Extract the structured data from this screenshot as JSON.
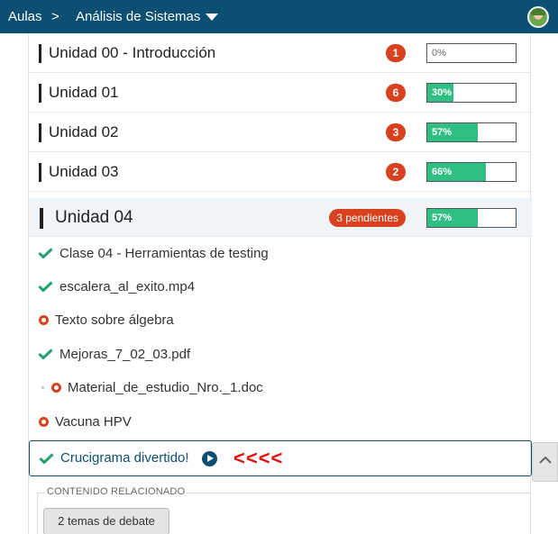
{
  "header": {
    "home_crumb": "Aulas",
    "separator": ">",
    "course_crumb": "Análisis de Sistemas"
  },
  "units": [
    {
      "title": "Unidad 00 - Introducción",
      "badge": "1",
      "progress_label": "0%",
      "progress": 0
    },
    {
      "title": "Unidad 01",
      "badge": "6",
      "progress_label": "30%",
      "progress": 0.3
    },
    {
      "title": "Unidad 02",
      "badge": "3",
      "progress_label": "57%",
      "progress": 0.57
    },
    {
      "title": "Unidad 03",
      "badge": "2",
      "progress_label": "66%",
      "progress": 0.66
    }
  ],
  "active_unit": {
    "title": "Unidad 04",
    "badge": "3 pendientes",
    "progress_label": "57%",
    "progress": 0.57
  },
  "items": [
    {
      "label": "Clase 04 - Herramientas de testing",
      "status": "done"
    },
    {
      "label": "escalera_al_exito.mp4",
      "status": "done"
    },
    {
      "label": "Texto sobre álgebra",
      "status": "pending"
    },
    {
      "label": "Mejoras_7_02_03.pdf",
      "status": "done"
    },
    {
      "label": "Material_de_estudio_Nro._1.doc",
      "status": "pending"
    },
    {
      "label": "Vacuna HPV",
      "status": "pending"
    },
    {
      "label": "Crucigrama divertido!",
      "status": "done"
    }
  ],
  "annotation": "<<<<",
  "related": {
    "legend": "CONTENIDO RELACIONADO",
    "button": "2 temas de debate"
  },
  "colors": {
    "header_bg": "#0d4f73",
    "badge": "#d9411e",
    "progress_fill": "#2fbf82",
    "check": "#1fa36b",
    "annotation": "#e01010"
  }
}
